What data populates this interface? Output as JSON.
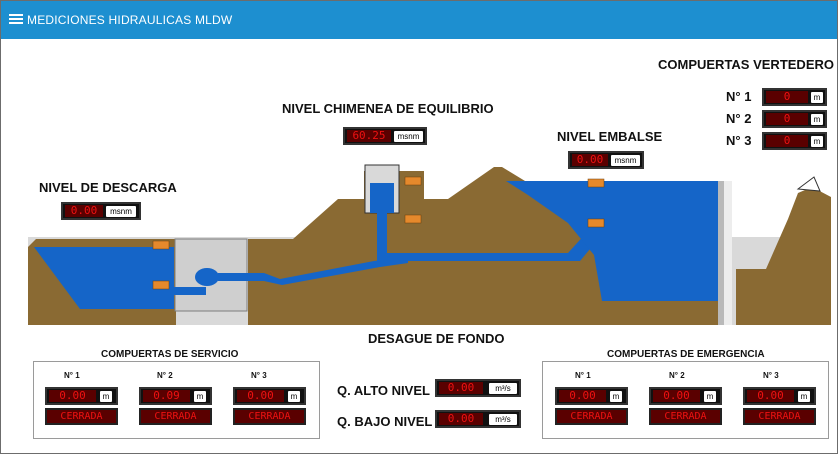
{
  "app": {
    "title": "MEDICIONES HIDRAULICAS MLDW"
  },
  "labels": {
    "nivel_chimenea": "NIVEL CHIMENEA DE EQUILIBRIO",
    "nivel_embalse": "NIVEL EMBALSE",
    "nivel_descarga": "NIVEL DE DESCARGA",
    "compuertas_vertedero": "COMPUERTAS VERTEDERO",
    "desague_fondo": "DESAGUE DE FONDO",
    "compuertas_servicio": "COMPUERTAS DE SERVICIO",
    "compuertas_emergencia": "COMPUERTAS DE EMERGENCIA",
    "q_alto": "Q. ALTO NIVEL",
    "q_bajo": "Q. BAJO NIVEL"
  },
  "readings": {
    "chimenea": {
      "value": "60.25",
      "unit": "msnm"
    },
    "embalse": {
      "value": "0.00",
      "unit": "msnm"
    },
    "descarga": {
      "value": "0.00",
      "unit": "msnm"
    },
    "q_alto": {
      "value": "0.00",
      "unit": "m³/s"
    },
    "q_bajo": {
      "value": "0.00",
      "unit": "m³/s"
    }
  },
  "vertedero": [
    {
      "label": "N° 1",
      "value": "0",
      "unit": "m"
    },
    {
      "label": "N° 2",
      "value": "0",
      "unit": "m"
    },
    {
      "label": "N° 3",
      "value": "0",
      "unit": "m"
    }
  ],
  "servicio": [
    {
      "label": "N° 1",
      "value": "0.00",
      "unit": "m",
      "status": "CERRADA"
    },
    {
      "label": "N° 2",
      "value": "0.09",
      "unit": "m",
      "status": "CERRADA"
    },
    {
      "label": "N° 3",
      "value": "0.00",
      "unit": "m",
      "status": "CERRADA"
    }
  ],
  "emergencia": [
    {
      "label": "N° 1",
      "value": "0.00",
      "unit": "m",
      "status": "CERRADA"
    },
    {
      "label": "N° 2",
      "value": "0.00",
      "unit": "m",
      "status": "CERRADA"
    },
    {
      "label": "N° 3",
      "value": "0.00",
      "unit": "m",
      "status": "CERRADA"
    }
  ],
  "colors": {
    "header": "#1d8fd0",
    "water": "#1565c8",
    "soil": "#8a6a33",
    "concrete": "#cfcfcf",
    "display_red": "#e11111"
  }
}
